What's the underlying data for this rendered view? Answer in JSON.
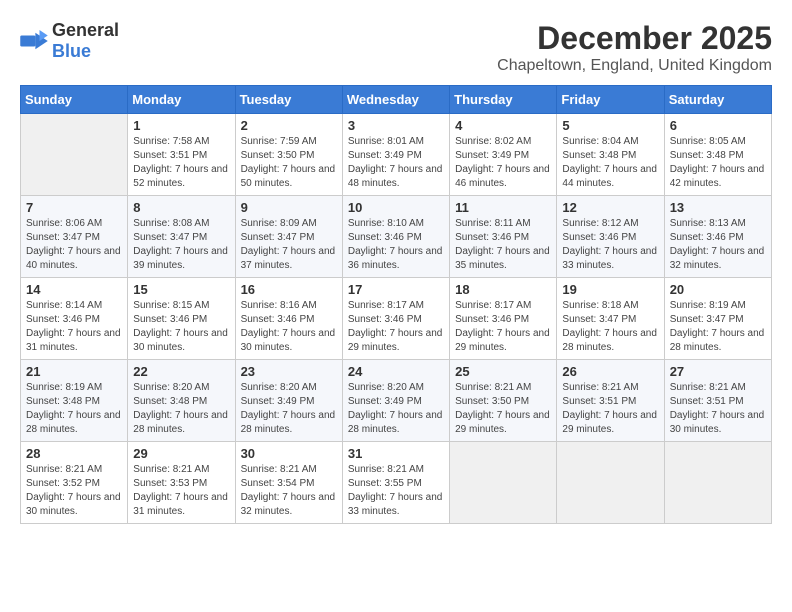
{
  "header": {
    "logo_general": "General",
    "logo_blue": "Blue",
    "month": "December 2025",
    "location": "Chapeltown, England, United Kingdom"
  },
  "days_of_week": [
    "Sunday",
    "Monday",
    "Tuesday",
    "Wednesday",
    "Thursday",
    "Friday",
    "Saturday"
  ],
  "weeks": [
    [
      {
        "day": "",
        "empty": true
      },
      {
        "day": "1",
        "sunrise": "7:58 AM",
        "sunset": "3:51 PM",
        "daylight": "7 hours and 52 minutes."
      },
      {
        "day": "2",
        "sunrise": "7:59 AM",
        "sunset": "3:50 PM",
        "daylight": "7 hours and 50 minutes."
      },
      {
        "day": "3",
        "sunrise": "8:01 AM",
        "sunset": "3:49 PM",
        "daylight": "7 hours and 48 minutes."
      },
      {
        "day": "4",
        "sunrise": "8:02 AM",
        "sunset": "3:49 PM",
        "daylight": "7 hours and 46 minutes."
      },
      {
        "day": "5",
        "sunrise": "8:04 AM",
        "sunset": "3:48 PM",
        "daylight": "7 hours and 44 minutes."
      },
      {
        "day": "6",
        "sunrise": "8:05 AM",
        "sunset": "3:48 PM",
        "daylight": "7 hours and 42 minutes."
      }
    ],
    [
      {
        "day": "7",
        "sunrise": "8:06 AM",
        "sunset": "3:47 PM",
        "daylight": "7 hours and 40 minutes."
      },
      {
        "day": "8",
        "sunrise": "8:08 AM",
        "sunset": "3:47 PM",
        "daylight": "7 hours and 39 minutes."
      },
      {
        "day": "9",
        "sunrise": "8:09 AM",
        "sunset": "3:47 PM",
        "daylight": "7 hours and 37 minutes."
      },
      {
        "day": "10",
        "sunrise": "8:10 AM",
        "sunset": "3:46 PM",
        "daylight": "7 hours and 36 minutes."
      },
      {
        "day": "11",
        "sunrise": "8:11 AM",
        "sunset": "3:46 PM",
        "daylight": "7 hours and 35 minutes."
      },
      {
        "day": "12",
        "sunrise": "8:12 AM",
        "sunset": "3:46 PM",
        "daylight": "7 hours and 33 minutes."
      },
      {
        "day": "13",
        "sunrise": "8:13 AM",
        "sunset": "3:46 PM",
        "daylight": "7 hours and 32 minutes."
      }
    ],
    [
      {
        "day": "14",
        "sunrise": "8:14 AM",
        "sunset": "3:46 PM",
        "daylight": "7 hours and 31 minutes."
      },
      {
        "day": "15",
        "sunrise": "8:15 AM",
        "sunset": "3:46 PM",
        "daylight": "7 hours and 30 minutes."
      },
      {
        "day": "16",
        "sunrise": "8:16 AM",
        "sunset": "3:46 PM",
        "daylight": "7 hours and 30 minutes."
      },
      {
        "day": "17",
        "sunrise": "8:17 AM",
        "sunset": "3:46 PM",
        "daylight": "7 hours and 29 minutes."
      },
      {
        "day": "18",
        "sunrise": "8:17 AM",
        "sunset": "3:46 PM",
        "daylight": "7 hours and 29 minutes."
      },
      {
        "day": "19",
        "sunrise": "8:18 AM",
        "sunset": "3:47 PM",
        "daylight": "7 hours and 28 minutes."
      },
      {
        "day": "20",
        "sunrise": "8:19 AM",
        "sunset": "3:47 PM",
        "daylight": "7 hours and 28 minutes."
      }
    ],
    [
      {
        "day": "21",
        "sunrise": "8:19 AM",
        "sunset": "3:48 PM",
        "daylight": "7 hours and 28 minutes."
      },
      {
        "day": "22",
        "sunrise": "8:20 AM",
        "sunset": "3:48 PM",
        "daylight": "7 hours and 28 minutes."
      },
      {
        "day": "23",
        "sunrise": "8:20 AM",
        "sunset": "3:49 PM",
        "daylight": "7 hours and 28 minutes."
      },
      {
        "day": "24",
        "sunrise": "8:20 AM",
        "sunset": "3:49 PM",
        "daylight": "7 hours and 28 minutes."
      },
      {
        "day": "25",
        "sunrise": "8:21 AM",
        "sunset": "3:50 PM",
        "daylight": "7 hours and 29 minutes."
      },
      {
        "day": "26",
        "sunrise": "8:21 AM",
        "sunset": "3:51 PM",
        "daylight": "7 hours and 29 minutes."
      },
      {
        "day": "27",
        "sunrise": "8:21 AM",
        "sunset": "3:51 PM",
        "daylight": "7 hours and 30 minutes."
      }
    ],
    [
      {
        "day": "28",
        "sunrise": "8:21 AM",
        "sunset": "3:52 PM",
        "daylight": "7 hours and 30 minutes."
      },
      {
        "day": "29",
        "sunrise": "8:21 AM",
        "sunset": "3:53 PM",
        "daylight": "7 hours and 31 minutes."
      },
      {
        "day": "30",
        "sunrise": "8:21 AM",
        "sunset": "3:54 PM",
        "daylight": "7 hours and 32 minutes."
      },
      {
        "day": "31",
        "sunrise": "8:21 AM",
        "sunset": "3:55 PM",
        "daylight": "7 hours and 33 minutes."
      },
      {
        "day": "",
        "empty": true
      },
      {
        "day": "",
        "empty": true
      },
      {
        "day": "",
        "empty": true
      }
    ]
  ]
}
